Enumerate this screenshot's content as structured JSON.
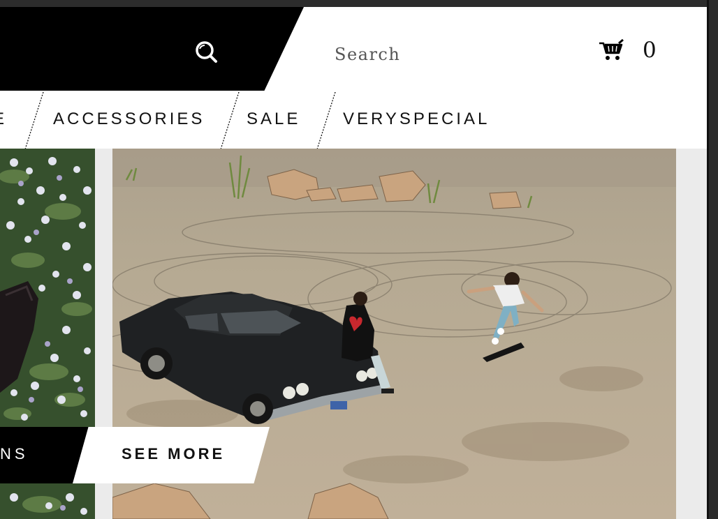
{
  "header": {
    "search_placeholder": "Search",
    "cart_count": "0"
  },
  "nav": {
    "items": [
      "E",
      "ACCESSORIES",
      "SALE",
      "VERYSPECIAL"
    ]
  },
  "hero": {
    "left_cta_label": "NS",
    "see_more_label": "SEE MORE"
  },
  "colors": {
    "header_black": "#000000",
    "page_bg": "#ebebeb",
    "asphalt": "#b9a98f"
  }
}
